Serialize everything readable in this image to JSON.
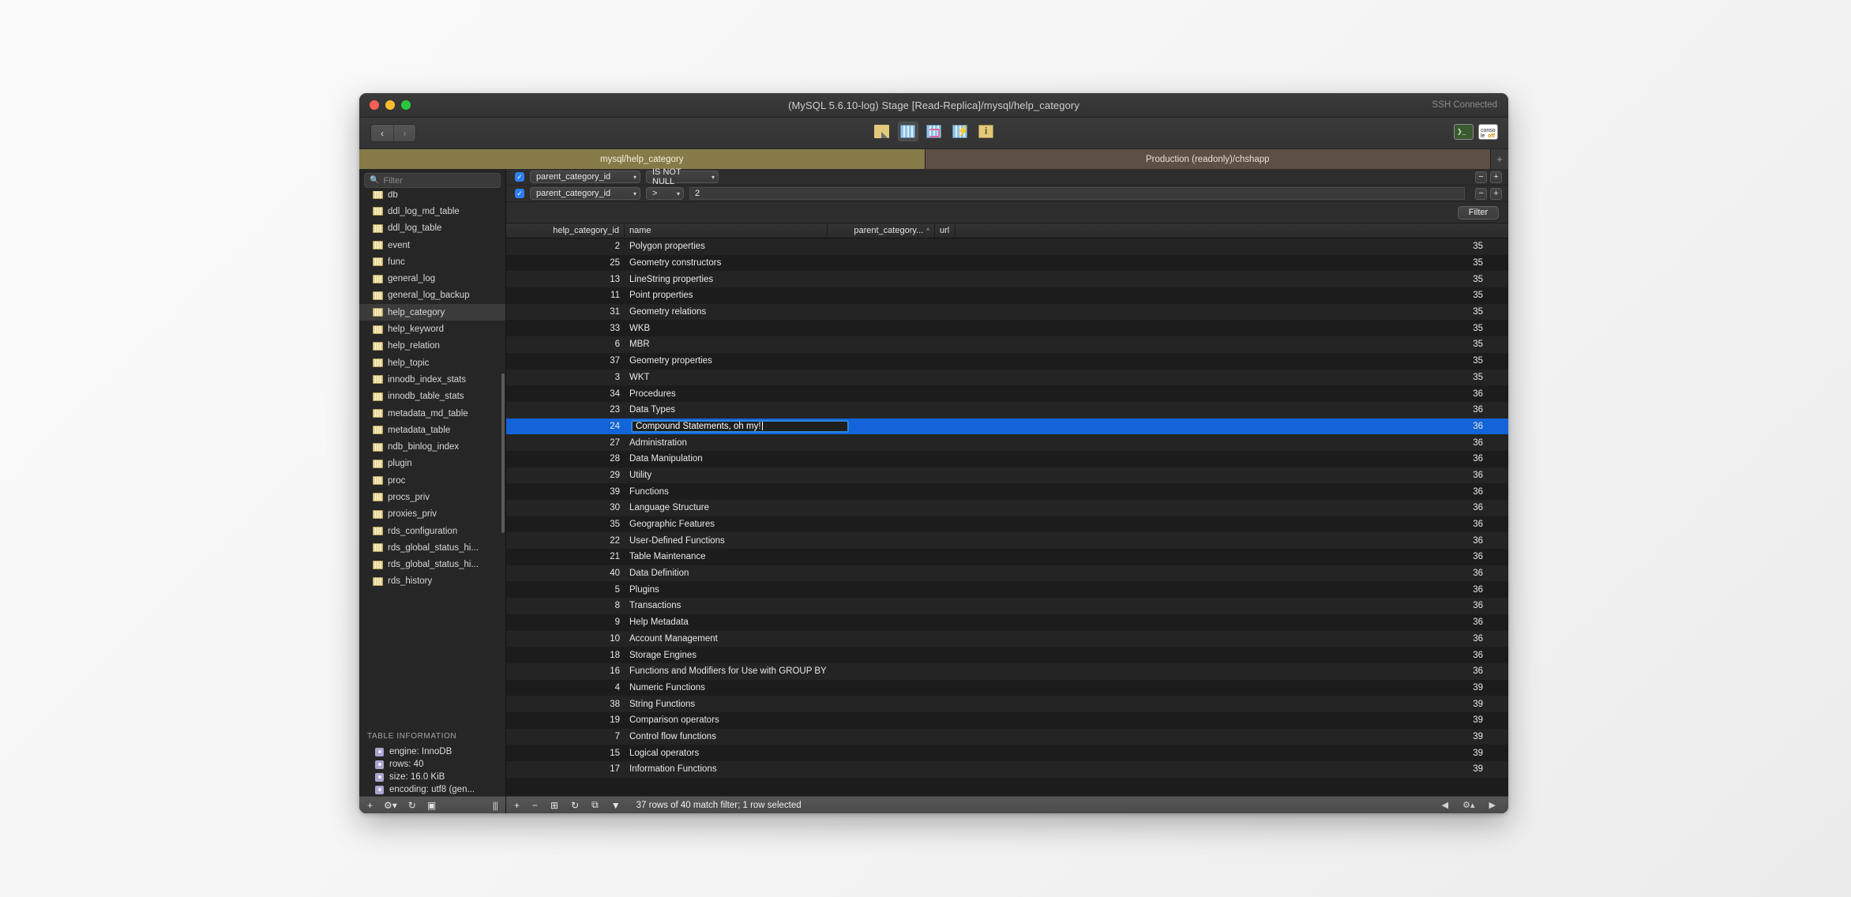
{
  "window": {
    "title": "(MySQL 5.6.10-log) Stage [Read-Replica]/mysql/help_category",
    "ssh_status": "SSH Connected"
  },
  "toolbar": {
    "back_glyph": "‹",
    "forward_glyph": "›",
    "icons": [
      {
        "name": "structure-icon",
        "label": "Structure"
      },
      {
        "name": "content-icon",
        "label": "Content"
      },
      {
        "name": "relations-icon",
        "label": "Relations"
      },
      {
        "name": "query-icon",
        "label": "Query"
      },
      {
        "name": "info-icon",
        "label": "Table Info"
      }
    ],
    "terminal_label": "❯_",
    "console_line1": "conso",
    "console_line2": "le",
    "console_line3": "off"
  },
  "tabs": {
    "items": [
      {
        "label": "mysql/help_category",
        "active": true
      },
      {
        "label": "Production (readonly)/chshapp",
        "active": false
      }
    ],
    "add_label": "+"
  },
  "sidebar": {
    "search": {
      "placeholder": "Filter",
      "value": "",
      "icon": "search-icon"
    },
    "tables": [
      {
        "label": "db",
        "selected": false
      },
      {
        "label": "ddl_log_md_table",
        "selected": false
      },
      {
        "label": "ddl_log_table",
        "selected": false
      },
      {
        "label": "event",
        "selected": false
      },
      {
        "label": "func",
        "selected": false
      },
      {
        "label": "general_log",
        "selected": false
      },
      {
        "label": "general_log_backup",
        "selected": false
      },
      {
        "label": "help_category",
        "selected": true
      },
      {
        "label": "help_keyword",
        "selected": false
      },
      {
        "label": "help_relation",
        "selected": false
      },
      {
        "label": "help_topic",
        "selected": false
      },
      {
        "label": "innodb_index_stats",
        "selected": false
      },
      {
        "label": "innodb_table_stats",
        "selected": false
      },
      {
        "label": "metadata_md_table",
        "selected": false
      },
      {
        "label": "metadata_table",
        "selected": false
      },
      {
        "label": "ndb_binlog_index",
        "selected": false
      },
      {
        "label": "plugin",
        "selected": false
      },
      {
        "label": "proc",
        "selected": false
      },
      {
        "label": "procs_priv",
        "selected": false
      },
      {
        "label": "proxies_priv",
        "selected": false
      },
      {
        "label": "rds_configuration",
        "selected": false
      },
      {
        "label": "rds_global_status_hi...",
        "selected": false
      },
      {
        "label": "rds_global_status_hi...",
        "selected": false
      },
      {
        "label": "rds_history",
        "selected": false
      }
    ],
    "table_information": {
      "title": "TABLE INFORMATION",
      "rows": [
        "engine: InnoDB",
        "rows: 40",
        "size: 16.0 KiB",
        "encoding: utf8 (gen..."
      ]
    },
    "footer_icons": [
      "+",
      "⚙▾",
      "↻",
      "▣",
      "|||"
    ]
  },
  "filters": {
    "rows": [
      {
        "enabled": true,
        "check_glyph": "✓",
        "field": "parent_category_id",
        "operator": "IS NOT NULL",
        "value": null,
        "has_value_input": false,
        "minus": "−",
        "plus": "+"
      },
      {
        "enabled": true,
        "check_glyph": "✓",
        "field": "parent_category_id",
        "operator": ">",
        "value": "2",
        "has_value_input": true,
        "minus": "−",
        "plus": "+"
      }
    ],
    "apply_label": "Filter"
  },
  "grid": {
    "columns": [
      {
        "key": "help_category_id",
        "label": "help_category_id",
        "sorted": false
      },
      {
        "key": "name",
        "label": "name",
        "sorted": false
      },
      {
        "key": "parent_category_id",
        "label": "parent_category...",
        "sorted": true,
        "sort_glyph": "^"
      },
      {
        "key": "url",
        "label": "url",
        "sorted": false
      }
    ],
    "editing_row_id": 24,
    "editing_value": "Compound Statements, oh my!",
    "rows": [
      {
        "help_category_id": "2",
        "name": "Polygon properties",
        "parent_category_id": "35",
        "url": ""
      },
      {
        "help_category_id": "25",
        "name": "Geometry constructors",
        "parent_category_id": "35",
        "url": ""
      },
      {
        "help_category_id": "13",
        "name": "LineString properties",
        "parent_category_id": "35",
        "url": ""
      },
      {
        "help_category_id": "11",
        "name": "Point properties",
        "parent_category_id": "35",
        "url": ""
      },
      {
        "help_category_id": "31",
        "name": "Geometry relations",
        "parent_category_id": "35",
        "url": ""
      },
      {
        "help_category_id": "33",
        "name": "WKB",
        "parent_category_id": "35",
        "url": ""
      },
      {
        "help_category_id": "6",
        "name": "MBR",
        "parent_category_id": "35",
        "url": ""
      },
      {
        "help_category_id": "37",
        "name": "Geometry properties",
        "parent_category_id": "35",
        "url": ""
      },
      {
        "help_category_id": "3",
        "name": "WKT",
        "parent_category_id": "35",
        "url": ""
      },
      {
        "help_category_id": "34",
        "name": "Procedures",
        "parent_category_id": "36",
        "url": ""
      },
      {
        "help_category_id": "23",
        "name": "Data Types",
        "parent_category_id": "36",
        "url": ""
      },
      {
        "help_category_id": "24",
        "name": "Compound Statements, oh my!",
        "parent_category_id": "36",
        "url": "",
        "selected": true,
        "editing": true
      },
      {
        "help_category_id": "27",
        "name": "Administration",
        "parent_category_id": "36",
        "url": ""
      },
      {
        "help_category_id": "28",
        "name": "Data Manipulation",
        "parent_category_id": "36",
        "url": ""
      },
      {
        "help_category_id": "29",
        "name": "Utility",
        "parent_category_id": "36",
        "url": ""
      },
      {
        "help_category_id": "39",
        "name": "Functions",
        "parent_category_id": "36",
        "url": ""
      },
      {
        "help_category_id": "30",
        "name": "Language Structure",
        "parent_category_id": "36",
        "url": ""
      },
      {
        "help_category_id": "35",
        "name": "Geographic Features",
        "parent_category_id": "36",
        "url": ""
      },
      {
        "help_category_id": "22",
        "name": "User-Defined Functions",
        "parent_category_id": "36",
        "url": ""
      },
      {
        "help_category_id": "21",
        "name": "Table Maintenance",
        "parent_category_id": "36",
        "url": ""
      },
      {
        "help_category_id": "40",
        "name": "Data Definition",
        "parent_category_id": "36",
        "url": ""
      },
      {
        "help_category_id": "5",
        "name": "Plugins",
        "parent_category_id": "36",
        "url": ""
      },
      {
        "help_category_id": "8",
        "name": "Transactions",
        "parent_category_id": "36",
        "url": ""
      },
      {
        "help_category_id": "9",
        "name": "Help Metadata",
        "parent_category_id": "36",
        "url": ""
      },
      {
        "help_category_id": "10",
        "name": "Account Management",
        "parent_category_id": "36",
        "url": ""
      },
      {
        "help_category_id": "18",
        "name": "Storage Engines",
        "parent_category_id": "36",
        "url": ""
      },
      {
        "help_category_id": "16",
        "name": "Functions and Modifiers for Use with GROUP BY",
        "parent_category_id": "36",
        "url": ""
      },
      {
        "help_category_id": "4",
        "name": "Numeric Functions",
        "parent_category_id": "39",
        "url": ""
      },
      {
        "help_category_id": "38",
        "name": "String Functions",
        "parent_category_id": "39",
        "url": ""
      },
      {
        "help_category_id": "19",
        "name": "Comparison operators",
        "parent_category_id": "39",
        "url": ""
      },
      {
        "help_category_id": "7",
        "name": "Control flow functions",
        "parent_category_id": "39",
        "url": ""
      },
      {
        "help_category_id": "15",
        "name": "Logical operators",
        "parent_category_id": "39",
        "url": ""
      },
      {
        "help_category_id": "17",
        "name": "Information Functions",
        "parent_category_id": "39",
        "url": ""
      }
    ]
  },
  "statusbar": {
    "icons": [
      "+",
      "−",
      "⊞",
      "↻",
      "⧉",
      "▼"
    ],
    "message": "37 rows of 40 match filter; 1 row selected",
    "nav_prev": "◀",
    "nav_gear": "⚙▴",
    "nav_next": "▶"
  },
  "colors": {
    "accent": "#1264d8",
    "tab_active": "#867a49",
    "tab_inactive": "#5e4f45",
    "checkbox": "#2d7ff0",
    "edit_border": "#2d86d8"
  }
}
